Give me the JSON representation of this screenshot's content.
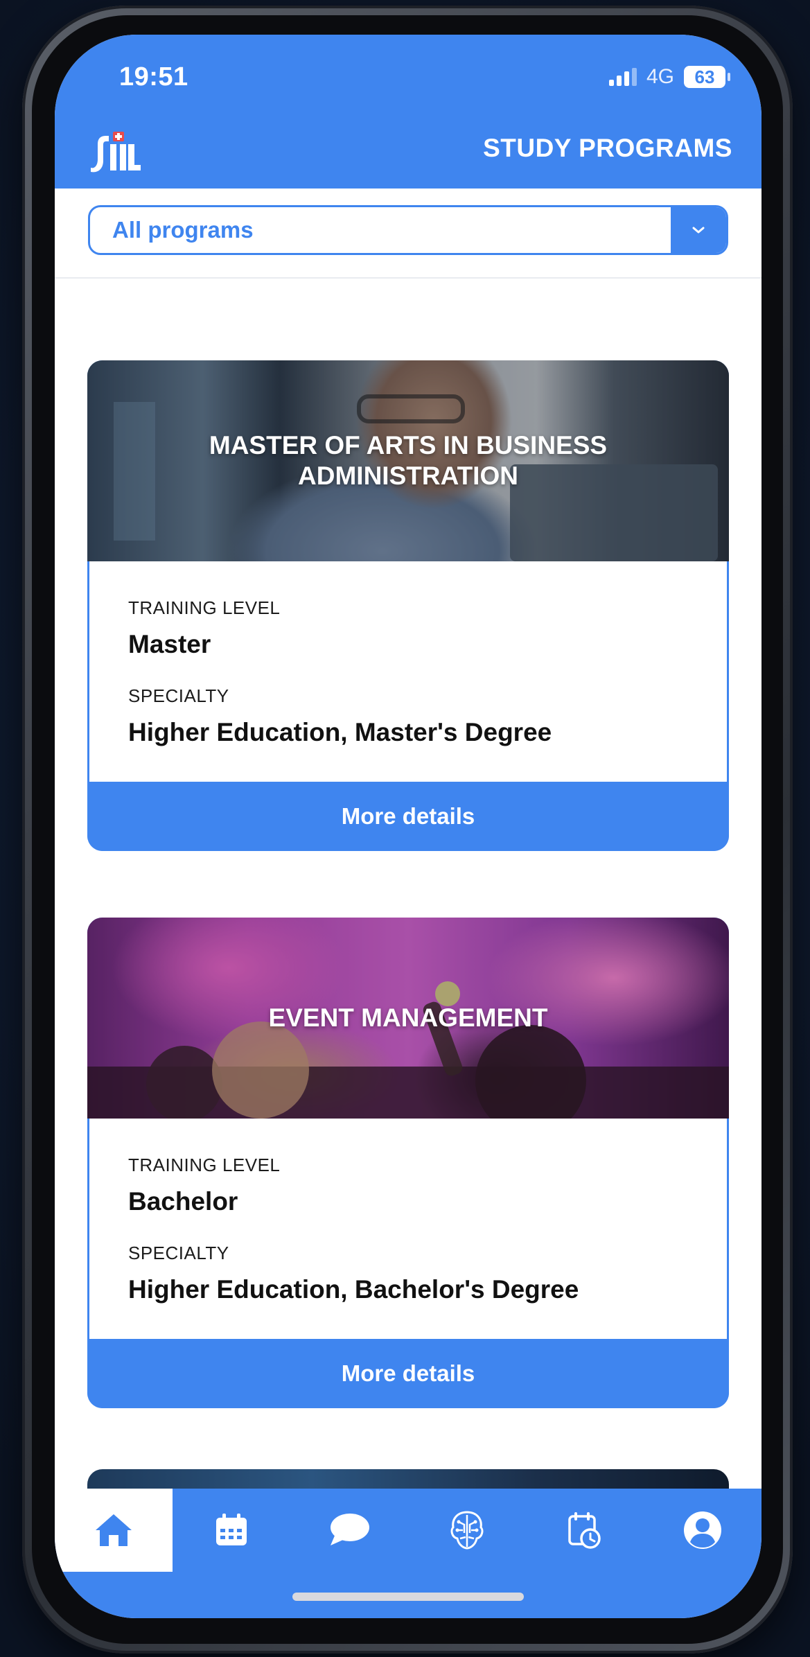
{
  "status_bar": {
    "time": "19:51",
    "network": "4G",
    "battery": "63"
  },
  "header": {
    "title": "STUDY PROGRAMS",
    "logo_icon": "sil-logo-icon"
  },
  "filter": {
    "selected": "All programs",
    "dropdown_icon": "chevron-down-icon"
  },
  "programs": [
    {
      "title": "MASTER OF ARTS IN BUSINESS ADMINISTRATION",
      "training_level_label": "TRAINING LEVEL",
      "training_level": "Master",
      "specialty_label": "SPECIALTY",
      "specialty": "Higher Education, Master's Degree",
      "button_label": "More details"
    },
    {
      "title": "EVENT MANAGEMENT",
      "training_level_label": "TRAINING LEVEL",
      "training_level": "Bachelor",
      "specialty_label": "SPECIALTY",
      "specialty": "Higher Education, Bachelor's Degree",
      "button_label": "More details"
    }
  ],
  "tabbar": {
    "active": "home",
    "items": [
      "home-icon",
      "calendar-icon",
      "chat-bubble-icon",
      "ai-brain-icon",
      "schedule-clock-icon",
      "profile-icon"
    ]
  },
  "colors": {
    "accent": "#3f85ef",
    "background_outer": "#0d1626",
    "card_border": "#3f85ef"
  }
}
